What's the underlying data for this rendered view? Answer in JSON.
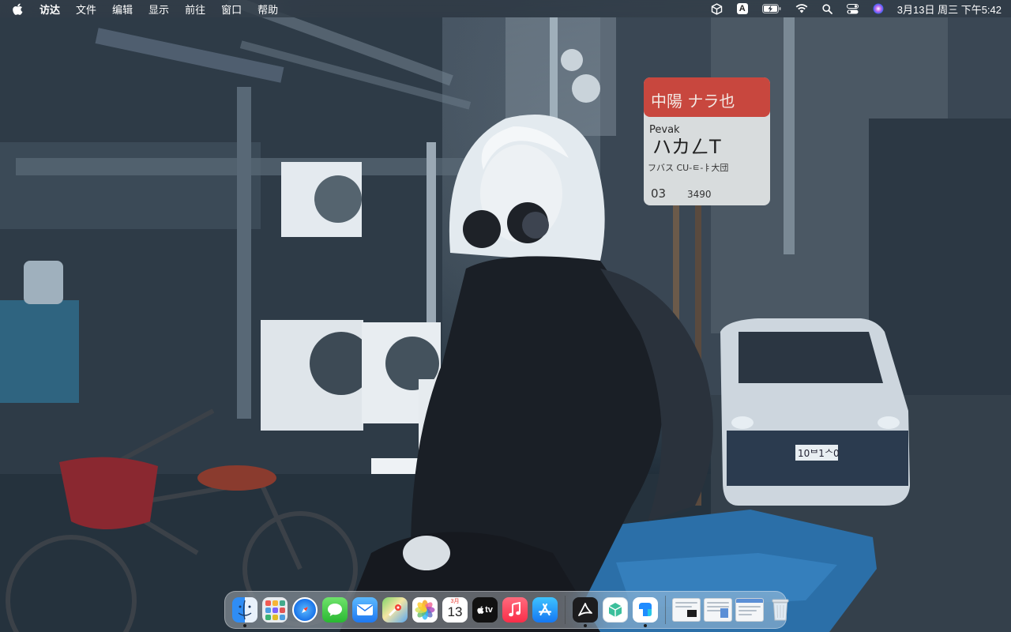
{
  "menubar": {
    "apple_icon": "apple-logo-icon",
    "app_name": "访达",
    "items": [
      "文件",
      "编辑",
      "显示",
      "前往",
      "窗口",
      "帮助"
    ],
    "status_icons": [
      "cube-app-icon",
      "input-method-icon",
      "battery-charging-icon",
      "wifi-icon",
      "search-icon",
      "control-center-icon",
      "siri-icon"
    ],
    "input_method_label": "A",
    "clock": "3月13日 周三 下午5:42"
  },
  "dock": {
    "apps": [
      {
        "name": "finder",
        "icon": "finder-icon",
        "running": true
      },
      {
        "name": "launchpad",
        "icon": "launchpad-icon",
        "running": false
      },
      {
        "name": "safari",
        "icon": "safari-icon",
        "running": false
      },
      {
        "name": "messages",
        "icon": "messages-icon",
        "running": false
      },
      {
        "name": "mail",
        "icon": "mail-icon",
        "running": false
      },
      {
        "name": "maps",
        "icon": "maps-icon",
        "running": false
      },
      {
        "name": "photos",
        "icon": "photos-icon",
        "running": false
      },
      {
        "name": "calendar",
        "icon": "calendar-icon",
        "running": false,
        "month": "3月",
        "day": "13"
      },
      {
        "name": "tv",
        "icon": "apple-tv-icon",
        "running": false,
        "label": "tv"
      },
      {
        "name": "music",
        "icon": "music-icon",
        "running": false
      },
      {
        "name": "app-store",
        "icon": "app-store-icon",
        "running": false
      }
    ],
    "recent_apps": [
      {
        "name": "acrobat",
        "icon": "acrobat-icon",
        "running": true
      },
      {
        "name": "cube",
        "icon": "cube-app-icon",
        "running": false
      },
      {
        "name": "tencent-meeting",
        "icon": "tencent-meeting-icon",
        "running": true
      }
    ],
    "minimized_windows": 3,
    "trash_icon": "trash-icon"
  },
  "wallpaper": {
    "sign_lines": [
      "中陽 ナラ也",
      "Pevak",
      "ハカㄥT",
      "フバス CU-ㅌ-ㅑ大団",
      "03",
      "3490"
    ],
    "license_plate": "10ᄇ1ᄉ0"
  },
  "colors": {
    "menubar_bg": "#1e2630",
    "dock_bg": "#ebf0f5",
    "accent_blue": "#1e78f0"
  }
}
